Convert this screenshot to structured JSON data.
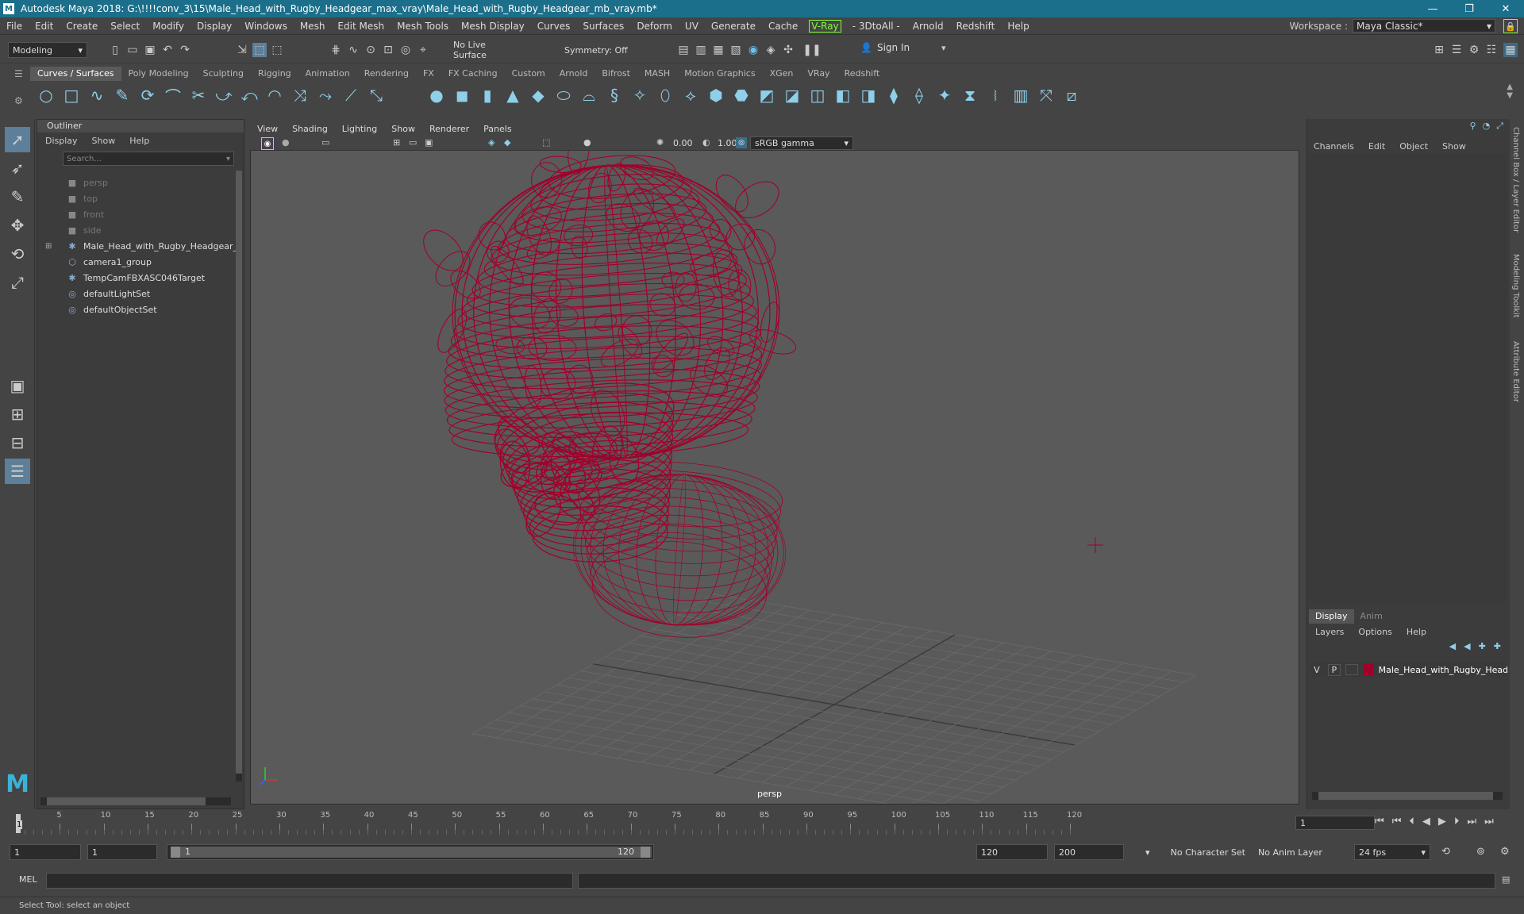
{
  "window": {
    "title": "Autodesk Maya 2018: G:\\!!!!conv_3\\15\\Male_Head_with_Rugby_Headgear_max_vray\\Male_Head_with_Rugby_Headgear_mb_vray.mb*",
    "logo": "M"
  },
  "menubar": {
    "items": [
      "File",
      "Edit",
      "Create",
      "Select",
      "Modify",
      "Display",
      "Windows",
      "Mesh",
      "Edit Mesh",
      "Mesh Tools",
      "Mesh Display",
      "Curves",
      "Surfaces",
      "Deform",
      "UV",
      "Generate",
      "Cache"
    ],
    "vray": "V-Ray",
    "items2": [
      "- 3DtoAll -",
      "Arnold",
      "Redshift",
      "Help"
    ],
    "workspace_label": "Workspace :",
    "workspace_value": "Maya Classic*"
  },
  "statusline": {
    "mode": "Modeling",
    "live_surface": "No Live Surface",
    "symmetry": "Symmetry: Off",
    "sign_in": "Sign In"
  },
  "shelf": {
    "tabs": [
      "Curves / Surfaces",
      "Poly Modeling",
      "Sculpting",
      "Rigging",
      "Animation",
      "Rendering",
      "FX",
      "FX Caching",
      "Custom",
      "Arnold",
      "Bifrost",
      "MASH",
      "Motion Graphics",
      "XGen",
      "VRay",
      "Redshift"
    ],
    "active": "Curves / Surfaces"
  },
  "outliner": {
    "title": "Outliner",
    "menu": [
      "Display",
      "Show",
      "Help"
    ],
    "search_placeholder": "Search...",
    "items": [
      {
        "label": "persp",
        "icon": "camera-icon",
        "dim": true
      },
      {
        "label": "top",
        "icon": "camera-icon",
        "dim": true
      },
      {
        "label": "front",
        "icon": "camera-icon",
        "dim": true
      },
      {
        "label": "side",
        "icon": "camera-icon",
        "dim": true
      },
      {
        "label": "Male_Head_with_Rugby_Headgear_n",
        "icon": "transform-icon",
        "expand": true
      },
      {
        "label": "camera1_group",
        "icon": "group-icon"
      },
      {
        "label": "TempCamFBXASC046Target",
        "icon": "transform-icon"
      },
      {
        "label": "defaultLightSet",
        "icon": "set-icon"
      },
      {
        "label": "defaultObjectSet",
        "icon": "set-icon"
      }
    ]
  },
  "viewport": {
    "menu": [
      "View",
      "Shading",
      "Lighting",
      "Show",
      "Renderer",
      "Panels"
    ],
    "exposure": "0.00",
    "gamma": "1.00",
    "colorspace": "sRGB gamma",
    "camera_label": "persp",
    "wire_color": "#a0002a"
  },
  "channelbox": {
    "menu": [
      "Channels",
      "Edit",
      "Object",
      "Show"
    ]
  },
  "layers": {
    "tabs": [
      "Display",
      "Anim"
    ],
    "menu": [
      "Layers",
      "Options",
      "Help"
    ],
    "row": {
      "v": "V",
      "p": "P",
      "name": "Male_Head_with_Rugby_Head",
      "color": "#a0002a"
    }
  },
  "sidetabs": [
    "Channel Box / Layer Editor",
    "Modeling Toolkit",
    "Attribute Editor"
  ],
  "timeline": {
    "ticks": [
      "5",
      "10",
      "15",
      "20",
      "25",
      "30",
      "35",
      "40",
      "45",
      "50",
      "55",
      "60",
      "65",
      "70",
      "75",
      "80",
      "85",
      "90",
      "95",
      "100",
      "105",
      "110",
      "115",
      "120"
    ],
    "current_frame": "1",
    "current_frame_field": "1"
  },
  "range": {
    "start": "1",
    "start2": "1",
    "range_start": "1",
    "range_end": "120",
    "end": "120",
    "end2": "200",
    "character_set": "No Character Set",
    "anim_layer": "No Anim Layer",
    "fps": "24 fps"
  },
  "mel": {
    "label": "MEL"
  },
  "help": {
    "text": "Select Tool: select an object"
  }
}
